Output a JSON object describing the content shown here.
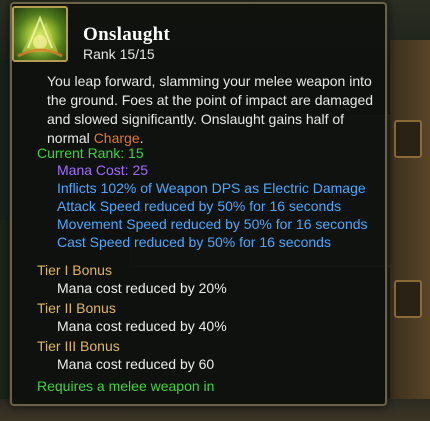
{
  "skill": {
    "name": "Onslaught",
    "rank": "Rank 15/15",
    "description_prefix": "You leap forward, slamming your melee weapon into the ground. Foes at the point of impact are damaged and slowed significantly. Onslaught gains half of normal ",
    "description_charge": "Charge",
    "description_suffix": "."
  },
  "current_rank": {
    "label": "Current Rank: 15",
    "mana_cost": "Mana Cost: 25",
    "effects": [
      "Inflicts 102% of Weapon DPS as Electric Damage",
      "Attack Speed reduced by 50% for 16 seconds",
      "Movement Speed reduced by 50% for 16 seconds",
      "Cast Speed reduced by 50% for 16 seconds"
    ]
  },
  "tiers": [
    {
      "label": "Tier I Bonus",
      "text": "Mana cost reduced by 20%"
    },
    {
      "label": "Tier II Bonus",
      "text": "Mana cost reduced by 40%"
    },
    {
      "label": "Tier III Bonus",
      "text": "Mana cost reduced by 60"
    }
  ],
  "requirement": "Requires a melee weapon in",
  "icons": {
    "skill": "onslaught-skill-icon"
  },
  "colors": {
    "current_rank": "#3bd43b",
    "mana": "#a36bff",
    "effect": "#4aa8ff",
    "tier_label": "#e0b75a",
    "charge": "#e07a2c"
  }
}
